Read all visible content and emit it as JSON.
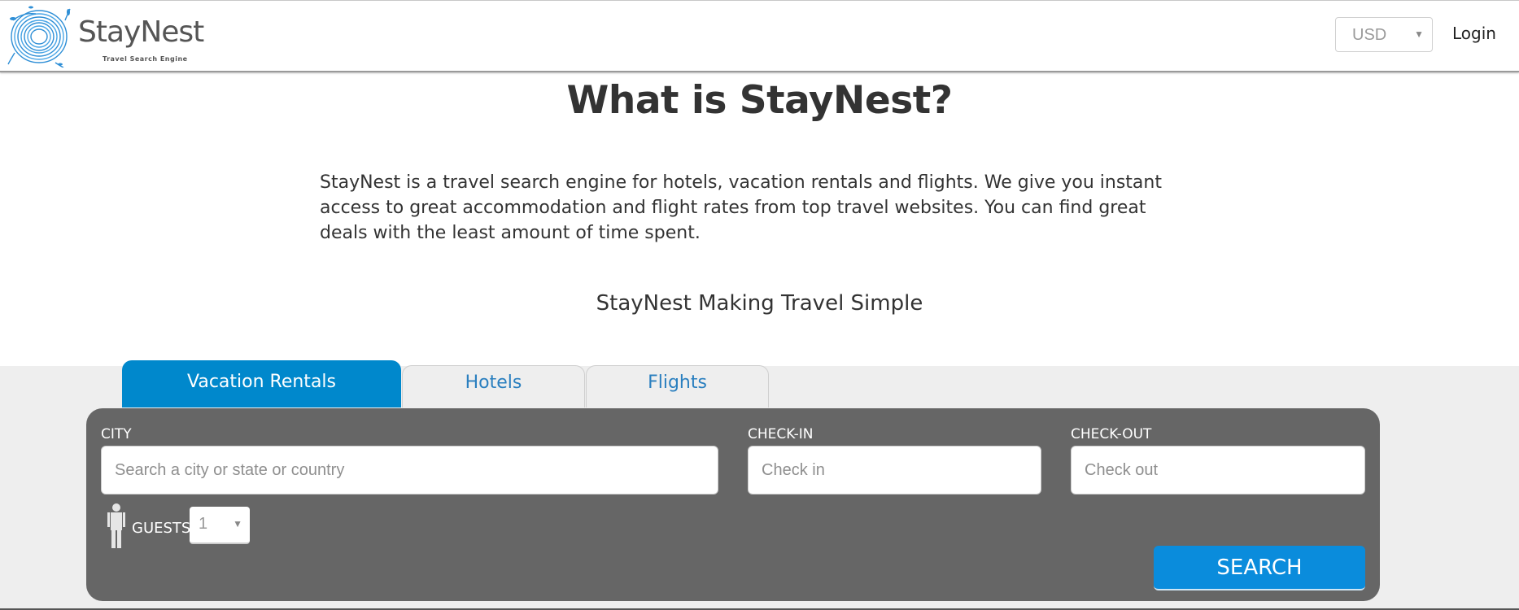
{
  "header": {
    "logo_name": "StayNest",
    "logo_tagline": "Travel  Search  Engine",
    "currency": {
      "selected": "USD"
    },
    "login_label": "Login"
  },
  "main": {
    "title": "What is StayNest?",
    "description": "StayNest is a travel search engine for hotels, vacation rentals and flights. We give you instant access to great accommodation and flight rates from top travel websites. You can find great deals with the least amount of time spent.",
    "tagline": "StayNest Making Travel Simple"
  },
  "search": {
    "tabs": [
      {
        "label": "Vacation Rentals",
        "active": true
      },
      {
        "label": "Hotels",
        "active": false
      },
      {
        "label": "Flights",
        "active": false
      }
    ],
    "city": {
      "label": "CITY",
      "value": "",
      "placeholder": "Search a city or state or country"
    },
    "checkin": {
      "label": "CHECK-IN",
      "value": "",
      "placeholder": "Check in"
    },
    "checkout": {
      "label": "CHECK-OUT",
      "value": "",
      "placeholder": "Check out"
    },
    "guests": {
      "label": "GUESTS",
      "selected": "1"
    },
    "search_label": "SEARCH"
  },
  "colors": {
    "accent": "#0088cc",
    "button": "#0a8cdc",
    "panel": "#666666",
    "tab_inactive_text": "#2a7fbf"
  }
}
